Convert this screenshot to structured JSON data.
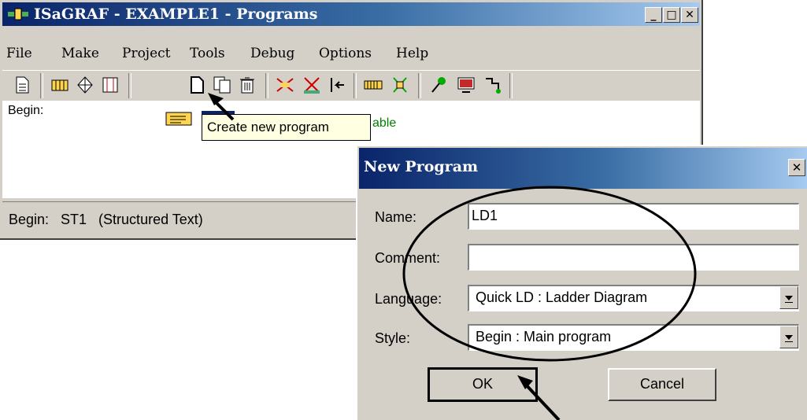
{
  "main_window": {
    "title": "ISaGRAF - EXAMPLE1 - Programs",
    "controls": {
      "minimize": "_",
      "maximize": "□",
      "close": "✕"
    },
    "menu": [
      {
        "label": "File"
      },
      {
        "label": "Make"
      },
      {
        "label": "Project"
      },
      {
        "label": "Tools"
      },
      {
        "label": "Debug"
      },
      {
        "label": "Options"
      },
      {
        "label": "Help"
      }
    ],
    "content": {
      "section_label": "Begin:",
      "partial_text": "able"
    },
    "status_bar": "Begin:   ST1   (Structured Text)"
  },
  "tooltip": "Create new program",
  "dialog": {
    "title": "New Program",
    "close": "✕",
    "name_label": "Name:",
    "name_value": "LD1",
    "comment_label": "Comment:",
    "comment_value": "",
    "language_label": "Language:",
    "language_value": "Quick LD : Ladder Diagram",
    "style_label": "Style:",
    "style_value": "Begin : Main program",
    "ok_label": "OK",
    "cancel_label": "Cancel"
  },
  "icons": [
    "app-icon",
    "new-file-icon",
    "dictionary-icon",
    "link-icon",
    "io-icon",
    "create-program-icon",
    "copy-icon",
    "delete-icon",
    "compile-icon",
    "verify-icon",
    "step-icon",
    "io-board-icon",
    "simulate-icon",
    "debug-icon",
    "display-icon",
    "link-tool-icon"
  ]
}
